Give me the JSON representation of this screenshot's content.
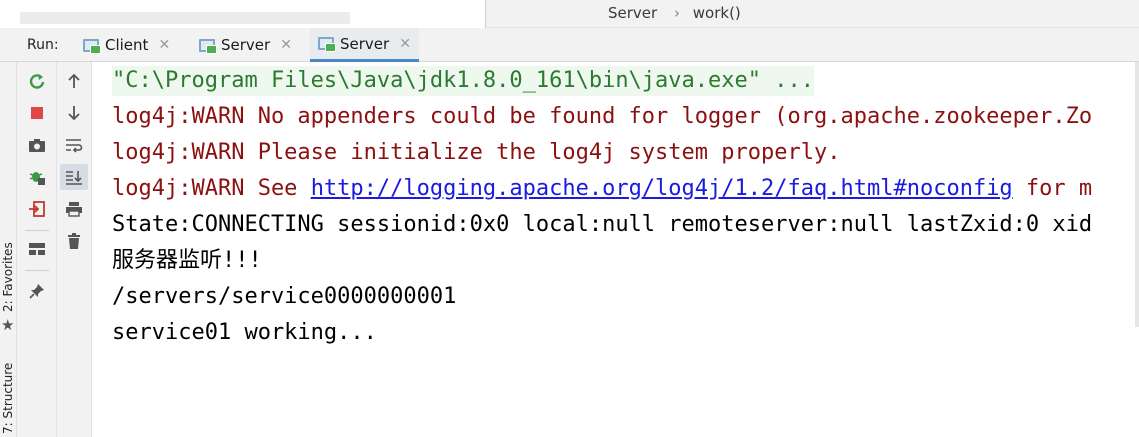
{
  "breadcrumb": {
    "items": [
      "Server",
      "work()"
    ],
    "separator": "›"
  },
  "run_panel": {
    "run_label": "Run:",
    "tabs": [
      {
        "label": "Client",
        "active": false
      },
      {
        "label": "Server",
        "active": false
      },
      {
        "label": "Server",
        "active": true
      }
    ],
    "close_glyph": "✕"
  },
  "side_tool_windows": [
    "2: Favorites",
    "7: Structure"
  ],
  "toolbar_left": [
    "rerun-icon",
    "stop-icon",
    "camera-icon",
    "debug-icon",
    "exit-icon",
    "layout-icon",
    "pin-icon"
  ],
  "toolbar_right": [
    "up-arrow-icon",
    "down-arrow-icon",
    "soft-wrap-icon",
    "scroll-to-end-icon",
    "print-icon",
    "trash-icon"
  ],
  "console": {
    "command_line": "\"C:\\Program Files\\Java\\jdk1.8.0_161\\bin\\java.exe\" ...",
    "warn_1": "log4j:WARN No appenders could be found for logger (org.apache.zookeeper.Zo",
    "warn_2": "log4j:WARN Please initialize the log4j system properly.",
    "warn_3_prefix": "log4j:WARN See ",
    "warn_3_link": "http://logging.apache.org/log4j/1.2/faq.html#noconfig",
    "warn_3_suffix": " for m",
    "state_line": "State:CONNECTING sessionid:0x0 local:null remoteserver:null lastZxid:0 xid",
    "listen_line": "服务器监听!!!",
    "path_line": "/servers/service0000000001",
    "working_line": "service01 working..."
  },
  "colors": {
    "command_green": "#2a7a30",
    "warn_red": "#8b1010",
    "link_blue": "#1a1ae0",
    "tab_underline": "#4a86c7"
  }
}
